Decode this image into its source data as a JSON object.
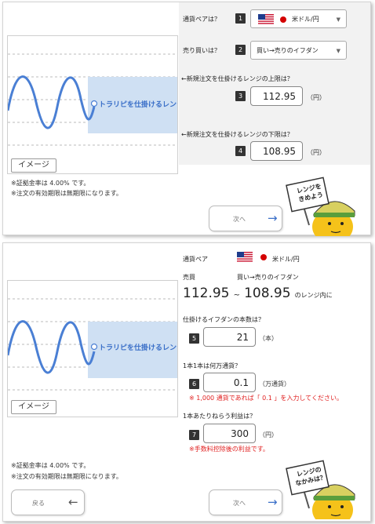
{
  "step1": {
    "chart": {
      "range_label": "トラリピを仕掛けるレンジ",
      "image_button": "イメージ"
    },
    "notes": [
      "※証拠金率は 4.00% です。",
      "※注文の有効期限は無期限になります。"
    ],
    "q_pair": {
      "label": "通貨ペアは？",
      "num": "1",
      "value": "米ドル/円"
    },
    "q_type": {
      "label": "売り買いは？",
      "num": "2",
      "value": "買い→売りのイフダン"
    },
    "q_upper": {
      "label": "←新規注文を仕掛けるレンジの上限は？",
      "num": "3",
      "value": "112.95",
      "unit": "（円）"
    },
    "q_lower": {
      "label": "←新規注文を仕掛けるレンジの下限は？",
      "num": "4",
      "value": "108.95",
      "unit": "（円）"
    },
    "next_button": {
      "label": "次へ",
      "arrow": "→"
    },
    "mascot": {
      "sign_line1": "レンジを",
      "sign_line2": "きめよう"
    }
  },
  "step2": {
    "chart": {
      "range_label": "トラリピを仕掛けるレンジ",
      "image_button": "イメージ"
    },
    "summary": {
      "pair_label": "通貨ペア",
      "pair_value": "米ドル/円",
      "type_label": "売買",
      "type_value": "買い→売りのイフダン",
      "upper": "112.95",
      "tilde": "~",
      "lower": "108.95",
      "range_suffix": "のレンジ内に"
    },
    "q_count": {
      "label": "仕掛けるイフダンの本数は？",
      "num": "5",
      "value": "21",
      "unit": "（本）"
    },
    "q_size": {
      "label": "1本1本は何万通貨？",
      "num": "6",
      "value": "0.1",
      "unit": "（万通貨）",
      "note": "※ 1,000 通貨であれば「 0.1 」を入力してください。"
    },
    "q_profit": {
      "label": "1本あたりねらう利益は？",
      "num": "7",
      "value": "300",
      "unit": "（円）",
      "note": "※手数料控除後の利益です。"
    },
    "notes": [
      "※証拠金率は 4.00% です。",
      "※注文の有効期限は無期限になります。"
    ],
    "back_button": {
      "label": "戻る",
      "arrow": "←"
    },
    "next_button": {
      "label": "次へ",
      "arrow": "→"
    },
    "mascot": {
      "sign_line1": "レンジの",
      "sign_line2": "なかみは？"
    }
  },
  "colors": {
    "accent_blue": "#4a7fd4",
    "range_fill": "#cfe0f3",
    "badge": "#333333",
    "red": "#e02020"
  }
}
